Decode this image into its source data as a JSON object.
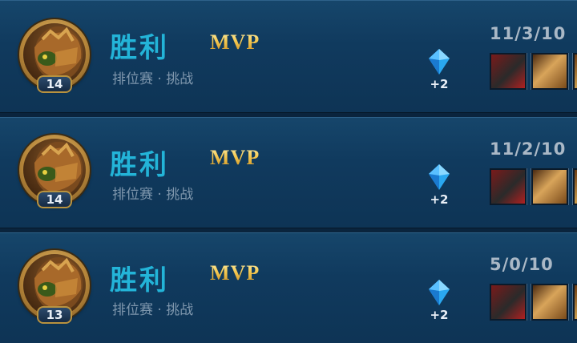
{
  "matches": [
    {
      "result": "胜利",
      "badge": "MVP",
      "mode": "排位赛 · 挑战",
      "level": "14",
      "reward": "+2",
      "kda": "11/3/10",
      "items": [
        "item-red-armor-icon",
        "item-gold-gauntlet-icon",
        "item-bronze-icon"
      ]
    },
    {
      "result": "胜利",
      "badge": "MVP",
      "mode": "排位赛 · 挑战",
      "level": "14",
      "reward": "+2",
      "kda": "11/2/10",
      "items": [
        "item-red-armor-icon",
        "item-gold-gauntlet-icon",
        "item-bronze-icon"
      ]
    },
    {
      "result": "胜利",
      "badge": "MVP",
      "mode": "排位赛 · 挑战",
      "level": "13",
      "reward": "+2",
      "kda": "5/0/10",
      "items": [
        "item-red-armor-icon",
        "item-gold-gauntlet-icon",
        "item-bronze-icon"
      ]
    }
  ],
  "colors": {
    "result": "#23b4d8",
    "mvp": "#f0c458",
    "mode": "#7f97ad",
    "kda": "#aab8c6",
    "background": "#103a5e"
  }
}
